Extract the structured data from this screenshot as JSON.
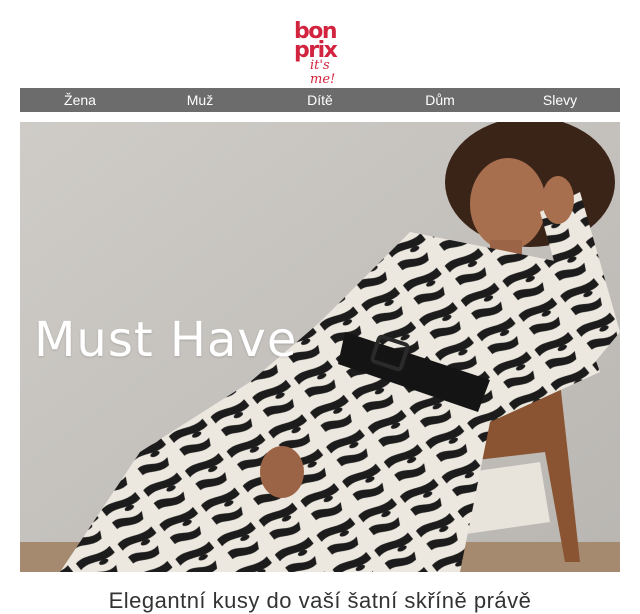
{
  "logo": {
    "line1": "bon",
    "line2": "prix",
    "tagline": "it's me!"
  },
  "nav": [
    "Žena",
    "Muž",
    "Dítě",
    "Dům",
    "Slevy"
  ],
  "hero": {
    "title": "Must Have"
  },
  "text": {
    "intro": "Elegantní kusy do vaší šatní skříně právě"
  },
  "colors": {
    "brand": "#d2243f",
    "nav_bg": "#6c6c6c"
  }
}
